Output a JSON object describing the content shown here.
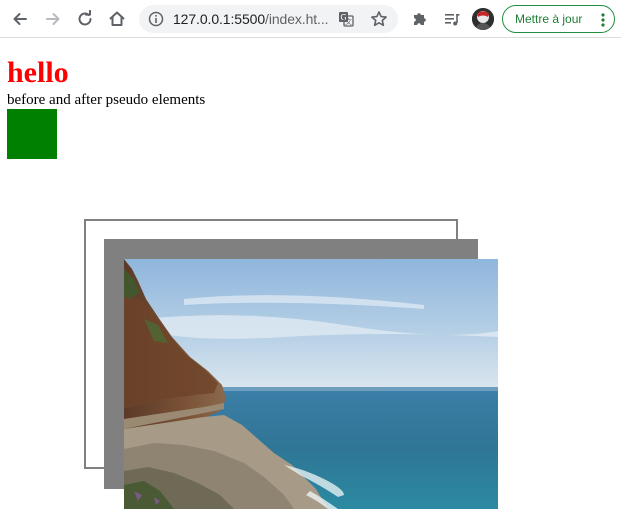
{
  "browser": {
    "url_host": "127.0.0.1:5500",
    "url_rest": "/index.ht...",
    "update_button_label": "Mettre à jour",
    "icons": {
      "back": "arrow-left",
      "forward": "arrow-right",
      "reload": "refresh",
      "home": "home",
      "info": "info-circle",
      "translate": "translate",
      "bookmark": "star-outline",
      "extensions": "puzzle-piece",
      "media": "playlist-music",
      "profile": "avatar",
      "menu": "vertical-dots"
    },
    "update_color": "#1e8e3e"
  },
  "page": {
    "heading": "hello",
    "heading_color": "#ff0000",
    "subtext": "before and after pseudo elements",
    "box_color": "#008000",
    "frame_color": "#808080",
    "image_subject": "coastal cliff and ocean photograph"
  }
}
